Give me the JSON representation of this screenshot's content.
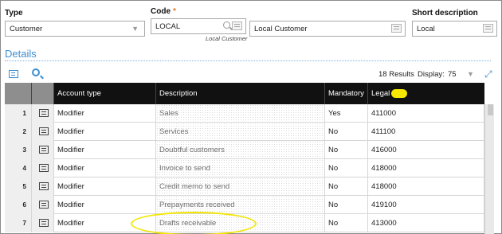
{
  "header": {
    "type_label": "Type",
    "type_value": "Customer",
    "code_label": "Code",
    "code_required": "*",
    "code_value": "LOCAL",
    "code_subtext": "Local Customer",
    "name_value": "Local Customer",
    "short_desc_label": "Short description",
    "short_desc_value": "Local"
  },
  "details": {
    "title": "Details",
    "results_text": "18 Results",
    "display_label": "Display:",
    "display_value": "75"
  },
  "grid": {
    "columns": [
      "Account type",
      "Description",
      "Mandatory",
      "Legal"
    ],
    "rows": [
      {
        "num": "1",
        "account_type": "Modifier",
        "description": "Sales",
        "mandatory": "Yes",
        "legal": "411000"
      },
      {
        "num": "2",
        "account_type": "Modifier",
        "description": "Services",
        "mandatory": "No",
        "legal": "411100"
      },
      {
        "num": "3",
        "account_type": "Modifier",
        "description": "Doubtful customers",
        "mandatory": "No",
        "legal": "416000"
      },
      {
        "num": "4",
        "account_type": "Modifier",
        "description": "Invoice to send",
        "mandatory": "No",
        "legal": "418000"
      },
      {
        "num": "5",
        "account_type": "Modifier",
        "description": "Credit memo to send",
        "mandatory": "No",
        "legal": "418000"
      },
      {
        "num": "6",
        "account_type": "Modifier",
        "description": "Prepayments received",
        "mandatory": "No",
        "legal": "419100"
      },
      {
        "num": "7",
        "account_type": "Modifier",
        "description": "Drafts receivable",
        "mandatory": "No",
        "legal": "413000"
      }
    ]
  },
  "icons": {
    "row_detail": "list-detail-icon",
    "search": "search-icon",
    "expand": "expand-icon",
    "dropdown": "chevron-down-icon"
  },
  "colors": {
    "accent": "#3d8fd1",
    "required": "#e8741b",
    "header_bg": "#111111",
    "highlight": "#f6e800"
  }
}
